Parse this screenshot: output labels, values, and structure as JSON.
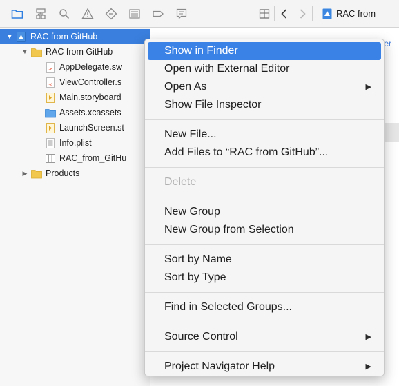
{
  "toolbar": {
    "icons": [
      "folder-icon",
      "hierarchy-icon",
      "magnifier-icon",
      "warning-icon",
      "diamond-icon",
      "list-icon",
      "tag-icon",
      "speech-bubble-icon"
    ]
  },
  "jump_bar": {
    "file_label": "RAC from"
  },
  "navigator": {
    "items": [
      {
        "label": "RAC from GitHub",
        "kind": "project",
        "selected": true,
        "disclosure": "expanded"
      },
      {
        "label": "RAC from GitHub",
        "kind": "folder",
        "disclosure": "expanded"
      },
      {
        "label": "AppDelegate.sw",
        "kind": "swift"
      },
      {
        "label": "ViewController.s",
        "kind": "swift"
      },
      {
        "label": "Main.storyboard",
        "kind": "storyboard"
      },
      {
        "label": "Assets.xcassets",
        "kind": "assets"
      },
      {
        "label": "LaunchScreen.st",
        "kind": "storyboard"
      },
      {
        "label": "Info.plist",
        "kind": "plist"
      },
      {
        "label": "RAC_from_GitHu",
        "kind": "header"
      },
      {
        "label": "Products",
        "kind": "folder",
        "disclosure": "collapsed"
      }
    ]
  },
  "editor": {
    "peek_text": "Ger"
  },
  "context_menu": {
    "groups": [
      [
        {
          "label": "Show in Finder",
          "highlighted": true
        },
        {
          "label": "Open with External Editor"
        },
        {
          "label": "Open As",
          "submenu": true
        },
        {
          "label": "Show File Inspector"
        }
      ],
      [
        {
          "label": "New File..."
        },
        {
          "label": "Add Files to “RAC from GitHub”..."
        }
      ],
      [
        {
          "label": "Delete",
          "disabled": true
        }
      ],
      [
        {
          "label": "New Group"
        },
        {
          "label": "New Group from Selection"
        }
      ],
      [
        {
          "label": "Sort by Name"
        },
        {
          "label": "Sort by Type"
        }
      ],
      [
        {
          "label": "Find in Selected Groups..."
        }
      ],
      [
        {
          "label": "Source Control",
          "submenu": true
        }
      ],
      [
        {
          "label": "Project Navigator Help",
          "submenu": true
        }
      ]
    ]
  },
  "colors": {
    "selection": "#3a7fde",
    "menu_highlight": "#3b82e6",
    "folder": "#f2c74e",
    "toolbar_active": "#2f7fe0"
  }
}
